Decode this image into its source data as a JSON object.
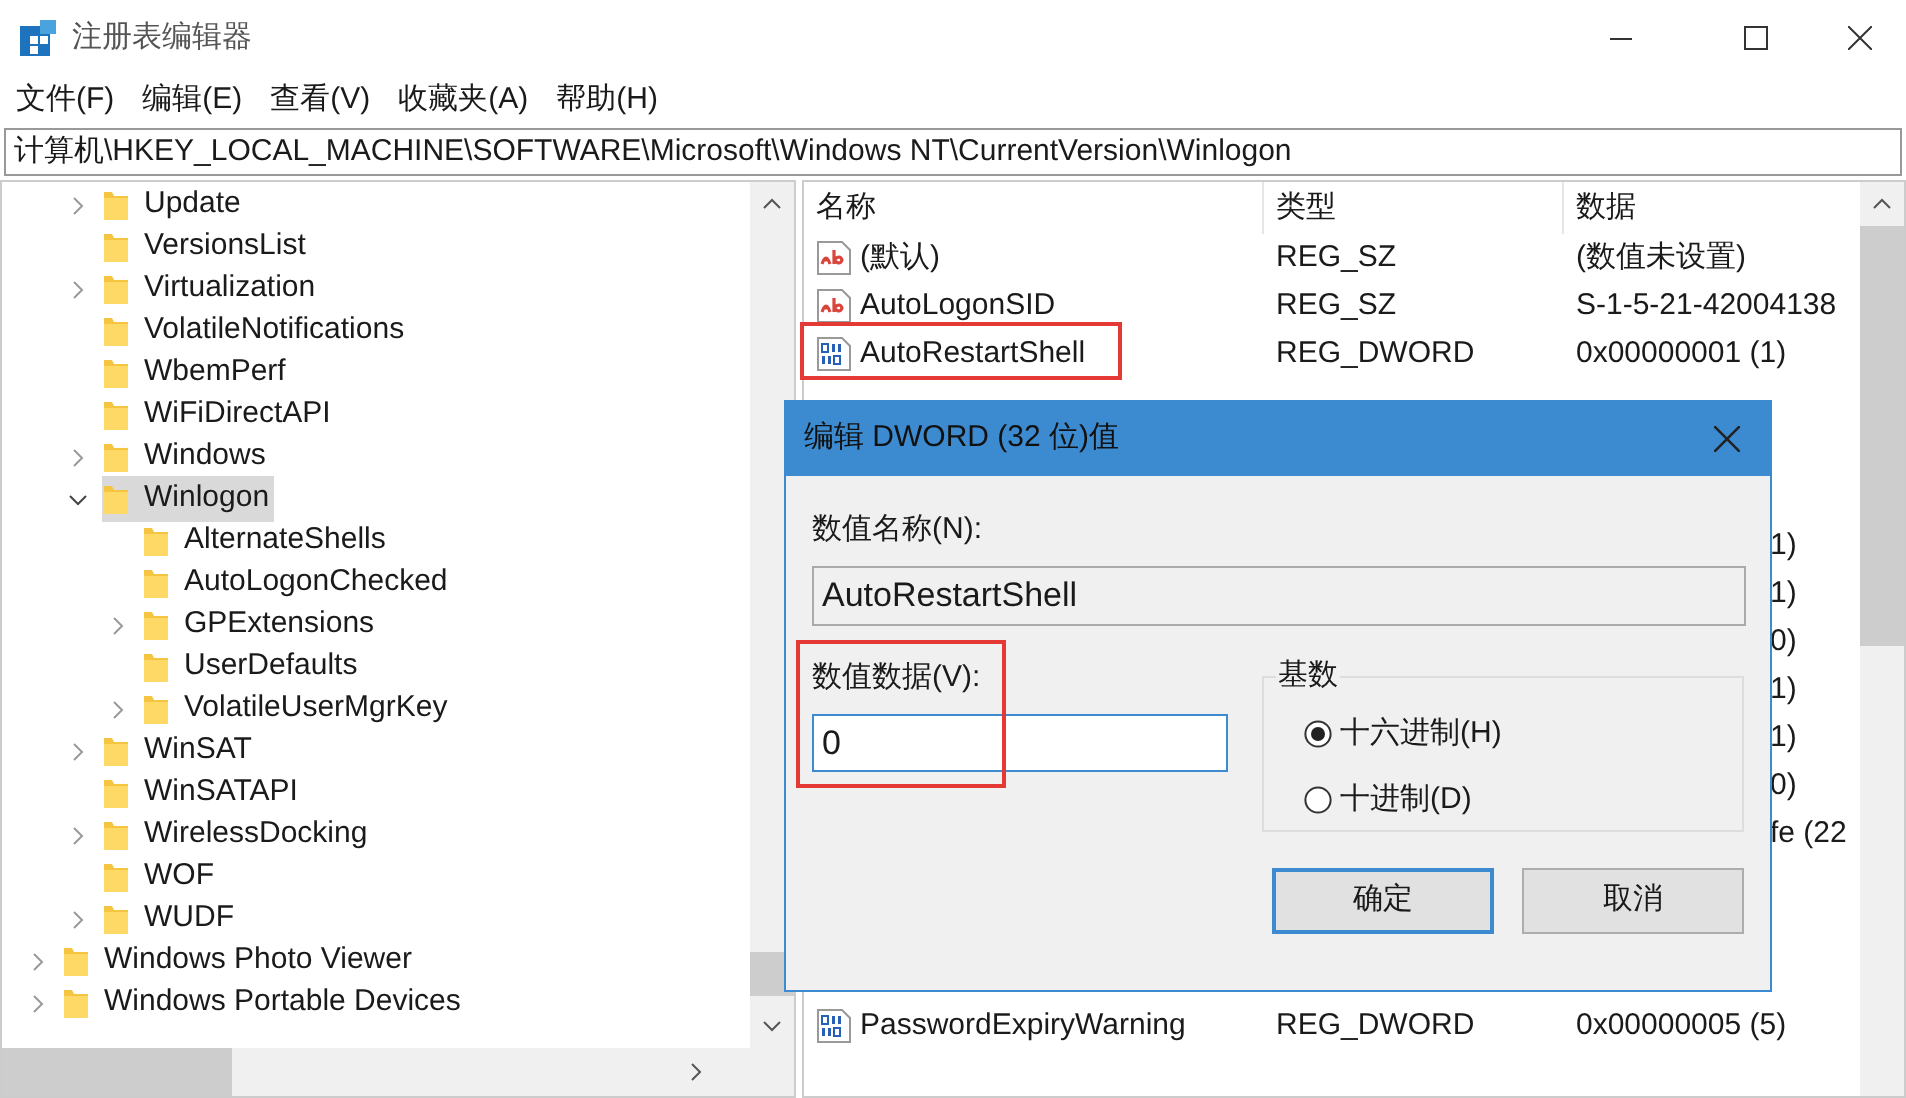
{
  "window": {
    "title": "注册表编辑器"
  },
  "menu": [
    "文件(F)",
    "编辑(E)",
    "查看(V)",
    "收藏夹(A)",
    "帮助(H)"
  ],
  "address": "计算机\\HKEY_LOCAL_MACHINE\\SOFTWARE\\Microsoft\\Windows NT\\CurrentVersion\\Winlogon",
  "tree": [
    {
      "children": [
        {
          "label": "Update",
          "expanded": false,
          "selected": false
        },
        {
          "label": "VersionsList",
          "selected": false
        },
        {
          "label": "Virtualization",
          "expanded": false,
          "selected": false
        },
        {
          "label": "VolatileNotifications",
          "selected": false
        },
        {
          "label": "WbemPerf",
          "selected": false
        },
        {
          "label": "WiFiDirectAPI",
          "selected": false
        },
        {
          "label": "Windows",
          "expanded": false,
          "selected": false
        },
        {
          "label": "Winlogon",
          "expanded": true,
          "selected": true,
          "children": [
            {
              "label": "AlternateShells",
              "selected": false
            },
            {
              "label": "AutoLogonChecked",
              "selected": false
            },
            {
              "label": "GPExtensions",
              "expanded": false,
              "selected": false
            },
            {
              "label": "UserDefaults",
              "selected": false
            },
            {
              "label": "VolatileUserMgrKey",
              "expanded": false,
              "selected": false
            }
          ]
        },
        {
          "label": "WinSAT",
          "expanded": false,
          "selected": false
        },
        {
          "label": "WinSATAPI",
          "selected": false
        },
        {
          "label": "WirelessDocking",
          "expanded": false,
          "selected": false
        },
        {
          "label": "WOF",
          "selected": false
        },
        {
          "label": "WUDF",
          "expanded": false,
          "selected": false
        }
      ]
    },
    {
      "label": "Windows Photo Viewer",
      "expanded": false,
      "selected": false
    },
    {
      "label": "Windows Portable Devices",
      "expanded": false,
      "selected": false
    }
  ],
  "list": {
    "columns": [
      "名称",
      "类型",
      "数据"
    ],
    "rows": [
      {
        "kind": "string",
        "name": "(默认)",
        "type": "REG_SZ",
        "data": "(数值未设置)",
        "highlighted": false
      },
      {
        "kind": "string",
        "name": "AutoLogonSID",
        "type": "REG_SZ",
        "data": "S-1-5-21-42004138",
        "highlighted": false
      },
      {
        "kind": "dword",
        "name": "AutoRestartShell",
        "type": "REG_DWORD",
        "data": "0x00000001 (1)",
        "highlighted": true
      },
      {
        "kind": "covered"
      },
      {
        "kind": "covered"
      },
      {
        "kind": "covered"
      },
      {
        "kind": "partial",
        "data": "1)"
      },
      {
        "kind": "partial",
        "data": "1)"
      },
      {
        "kind": "partial",
        "data": "0)"
      },
      {
        "kind": "partial",
        "data": "1)"
      },
      {
        "kind": "partial",
        "data": "1)"
      },
      {
        "kind": "partial",
        "data": "0)"
      },
      {
        "kind": "partial",
        "data": "fe (22"
      },
      {
        "kind": "covered"
      },
      {
        "kind": "covered"
      },
      {
        "kind": "covered"
      },
      {
        "kind": "dword",
        "name": "PasswordExpiryWarning",
        "type": "REG_DWORD",
        "data": "0x00000005 (5)",
        "highlighted": false
      }
    ]
  },
  "dialog": {
    "title": "编辑 DWORD (32 位)值",
    "name_label": "数值名称(N):",
    "name_value": "AutoRestartShell",
    "data_label": {
      "text": "数值数据(V):",
      "highlighted": true
    },
    "data_value": "0",
    "base": {
      "title": "基数",
      "options": [
        {
          "label": "十六进制(H)",
          "selected": true
        },
        {
          "label": "十进制(D)",
          "selected": false
        }
      ]
    },
    "buttons": [
      {
        "label": "确定",
        "default": true
      },
      {
        "label": "取消",
        "default": false
      }
    ]
  }
}
